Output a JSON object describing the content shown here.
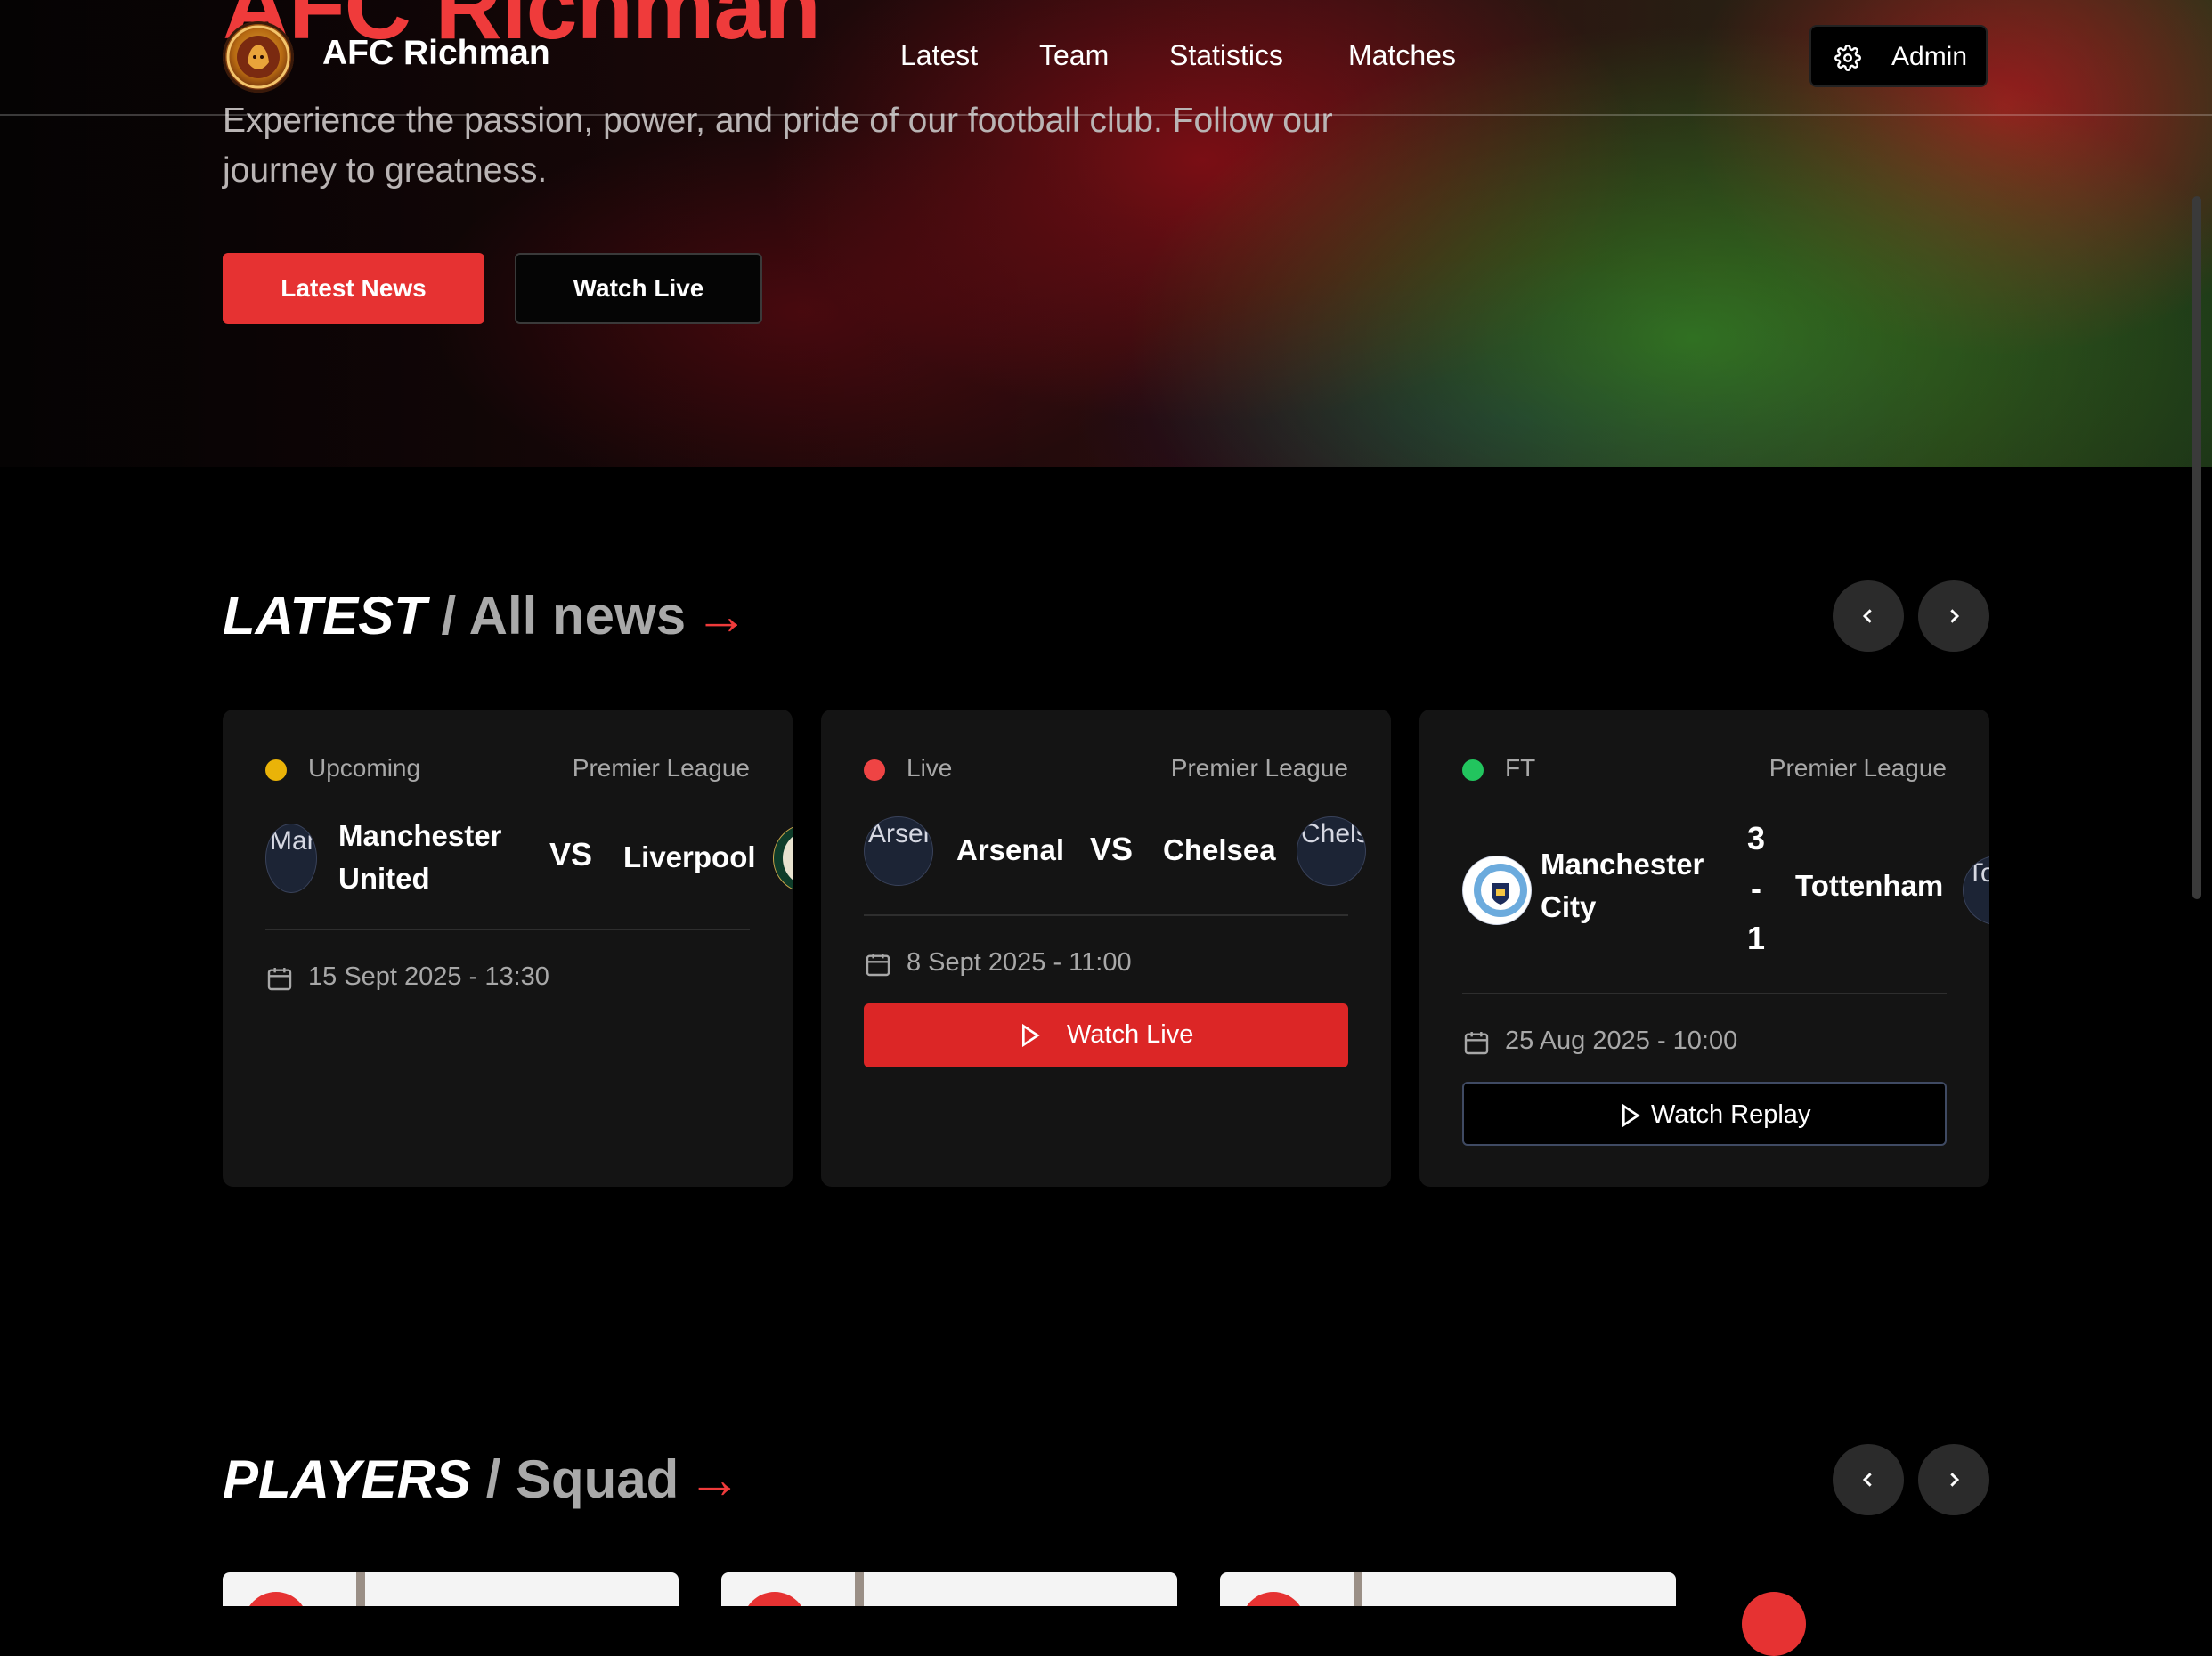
{
  "nav": {
    "brand": "AFC Richman",
    "links": [
      "Latest",
      "Team",
      "Statistics",
      "Matches"
    ],
    "admin_label": "Admin"
  },
  "hero": {
    "title": "AFC Richman",
    "subtitle": "Experience the passion, power, and pride of our football club. Follow our journey to greatness.",
    "primary_button": "Latest News",
    "secondary_button": "Watch Live"
  },
  "latest": {
    "title_strong": "LATEST",
    "title_muted": " / All news",
    "arrow": "→"
  },
  "matches": [
    {
      "status": "Upcoming",
      "status_color": "#eab308",
      "league": "Premier League",
      "home": "Manchester United",
      "home_logo_text": "Manchester United",
      "away": "Liverpool",
      "center": "VS",
      "date": "15 Sept 2025 - 13:30"
    },
    {
      "status": "Live",
      "status_color": "#ef4444",
      "league": "Premier League",
      "home": "Arsenal",
      "home_logo_text": "Arsenal",
      "away": "Chelsea",
      "away_logo_text": "Chelsea",
      "center": "VS",
      "date": "8 Sept 2025 - 11:00",
      "button": "Watch Live"
    },
    {
      "status": "FT",
      "status_color": "#22c55e",
      "league": "Premier League",
      "home": "Manchester City",
      "away": "Tottenham",
      "away_logo_text": "Tottenham",
      "score_home": "3",
      "score_sep": "-",
      "score_away": "1",
      "date": "25 Aug 2025 - 10:00",
      "button": "Watch Replay"
    }
  ],
  "players": {
    "title_strong": "PLAYERS",
    "title_muted": " / Squad",
    "arrow": "→"
  },
  "colors": {
    "accent": "#ef3b3b",
    "primary_button": "#e63232",
    "card_bg": "#141414"
  }
}
